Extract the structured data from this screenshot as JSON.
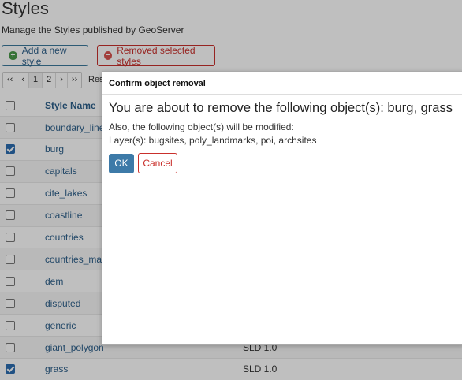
{
  "page": {
    "title": "Styles",
    "description": "Manage the Styles published by GeoServer"
  },
  "toolbar": {
    "add_label": "Add a new style",
    "remove_label": "Removed selected styles"
  },
  "pager": {
    "first": "‹‹",
    "prev": "‹",
    "pages": [
      "1",
      "2"
    ],
    "next": "›",
    "last": "››",
    "results_label": "Res"
  },
  "table": {
    "columns": {
      "name": "Style Name"
    },
    "rows": [
      {
        "name": "boundary_lines",
        "checked": false,
        "format": ""
      },
      {
        "name": "burg",
        "checked": true,
        "format": ""
      },
      {
        "name": "capitals",
        "checked": false,
        "format": ""
      },
      {
        "name": "cite_lakes",
        "checked": false,
        "format": ""
      },
      {
        "name": "coastline",
        "checked": false,
        "format": ""
      },
      {
        "name": "countries",
        "checked": false,
        "format": ""
      },
      {
        "name": "countries_mapc",
        "checked": false,
        "format": ""
      },
      {
        "name": "dem",
        "checked": false,
        "format": ""
      },
      {
        "name": "disputed",
        "checked": false,
        "format": ""
      },
      {
        "name": "generic",
        "checked": false,
        "format": ""
      },
      {
        "name": "giant_polygon",
        "checked": false,
        "format": "SLD 1.0"
      },
      {
        "name": "grass",
        "checked": true,
        "format": "SLD 1.0"
      }
    ]
  },
  "modal": {
    "title": "Confirm object removal",
    "headline": "You are about to remove the following object(s): burg, grass",
    "modified_note": "Also, the following object(s) will be modified:",
    "layers_line": "Layer(s): bugsites, poly_landmarks, poi, archsites",
    "ok_label": "OK",
    "cancel_label": "Cancel"
  },
  "colors": {
    "accent": "#2d5f8a",
    "danger": "#c9302c",
    "ok_button": "#3d7aa8"
  }
}
